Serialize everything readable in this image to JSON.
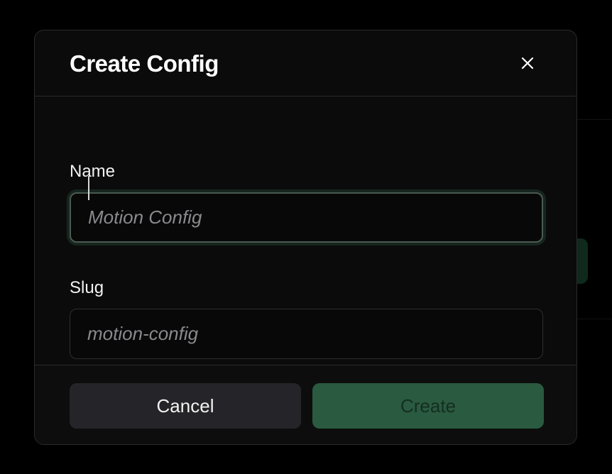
{
  "dialog": {
    "title": "Create Config",
    "close_icon": "close-icon"
  },
  "form": {
    "name": {
      "label": "Name",
      "placeholder": "Motion Config",
      "value": "",
      "focused": true
    },
    "slug": {
      "label": "Slug",
      "placeholder": "motion-config",
      "value": ""
    }
  },
  "footer": {
    "cancel_label": "Cancel",
    "create_label": "Create",
    "create_enabled": false
  },
  "colors": {
    "background": "#000000",
    "modal": "#0b0b0c",
    "accent": "#2a5a40",
    "cancel": "#252529"
  }
}
